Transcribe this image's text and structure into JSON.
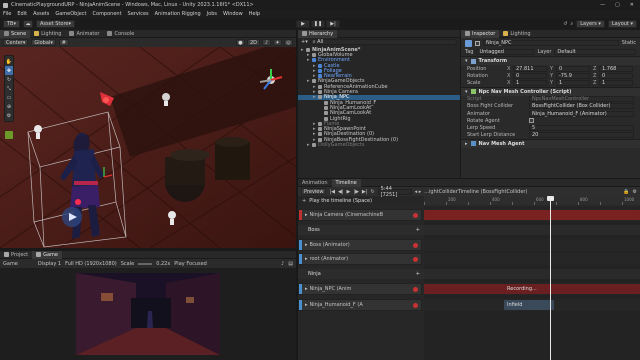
{
  "window": {
    "title": "CinematicPlaygroundURP - NinjaAnimScene - Windows, Mac, Linux - Unity 2023.1.16f1* <DX11>"
  },
  "menu": [
    "File",
    "Edit",
    "Assets",
    "GameObject",
    "Component",
    "Services",
    "Animation Rigging",
    "Jobs",
    "Window",
    "Help"
  ],
  "toolbar": {
    "account": "TB",
    "asset_store": "Asset Store",
    "layers": "Layers",
    "layout": "Layout"
  },
  "scene": {
    "tabs": [
      "Scene",
      "Lighting",
      "Animator",
      "Console"
    ],
    "pivot": "Center",
    "space": "Global",
    "view2d": "2D"
  },
  "game": {
    "tabs": [
      "Project",
      "Game"
    ],
    "mode": "Game",
    "display": "Display 1",
    "resolution": "Full HD (1920x1080)",
    "scale_label": "Scale",
    "scale_value": "0.22x",
    "play_mode": "Play Focused"
  },
  "hierarchy": {
    "tab": "Hierarchy",
    "search_prefix": "All",
    "items": [
      {
        "label": "NinjaAnimScene*",
        "depth": 0,
        "color": "#c8c8c8"
      },
      {
        "label": "GlobalVolume",
        "depth": 1,
        "color": "#c8c8c8"
      },
      {
        "label": "Environment",
        "depth": 1,
        "color": "#6fa8ff"
      },
      {
        "label": "Castle",
        "depth": 2,
        "color": "#6fa8ff"
      },
      {
        "label": "Foliage",
        "depth": 2,
        "color": "#6fa8ff"
      },
      {
        "label": "NewTerrain",
        "depth": 2,
        "color": "#6fa8ff"
      },
      {
        "label": "NinjaGameObjects",
        "depth": 1,
        "color": "#c8c8c8"
      },
      {
        "label": "ReferenceAnimationCube",
        "depth": 2,
        "color": "#c8c8c8"
      },
      {
        "label": "Ninja Camera",
        "depth": 2,
        "color": "#c8c8c8"
      },
      {
        "label": "Ninja_NPC",
        "depth": 2,
        "color": "#ffffff",
        "selected": true
      },
      {
        "label": "Ninja_Humanoid_F",
        "depth": 3,
        "color": "#c8c8c8"
      },
      {
        "label": "NinjaCamLookAt",
        "depth": 3,
        "color": "#c8c8c8"
      },
      {
        "label": "NinjaCamLookAt",
        "depth": 3,
        "color": "#c8c8c8"
      },
      {
        "label": "LightRig",
        "depth": 3,
        "color": "#c8c8c8"
      },
      {
        "label": "Flame",
        "depth": 2,
        "color": "#7a7a7a"
      },
      {
        "label": "NinjaSpawnPoint",
        "depth": 2,
        "color": "#c8c8c8"
      },
      {
        "label": "NinjaDestination (0)",
        "depth": 2,
        "color": "#c8c8c8"
      },
      {
        "label": "NinjaBossFightDestination (0)",
        "depth": 2,
        "color": "#c8c8c8"
      },
      {
        "label": "DollyGameObjects",
        "depth": 1,
        "color": "#7a7a7a"
      }
    ]
  },
  "inspector": {
    "tabs": [
      "Inspector",
      "Lighting"
    ],
    "object_name": "Ninja_NPC",
    "static_label": "Static",
    "tag_label": "Tag",
    "tag_value": "Untagged",
    "layer_label": "Layer",
    "layer_value": "Default",
    "transform": {
      "header": "Transform",
      "position": {
        "label": "Position",
        "x": "27.811",
        "y": "0",
        "z": "1.768"
      },
      "rotation": {
        "label": "Rotation",
        "x": "0",
        "y": "-75.9",
        "z": "0"
      },
      "scale": {
        "label": "Scale",
        "x": "1",
        "y": "1",
        "z": "1"
      }
    },
    "npc_script": {
      "header": "Npc Nav Mesh Controller (Script)",
      "rows": [
        {
          "label": "Script",
          "value": "NpcNavMeshController",
          "dim": true
        },
        {
          "label": "Boss Fight Collider",
          "value": "BossFightCollider (Box Collider)"
        },
        {
          "label": "Animator",
          "value": "Ninja_Humanoid_F (Animator)"
        },
        {
          "label": "Rotate Agent",
          "value": ""
        },
        {
          "label": "Lerp Speed",
          "value": "5"
        },
        {
          "label": "Start Lerp Distance",
          "value": "20"
        }
      ]
    },
    "nav_agent": {
      "header": "Nav Mesh Agent"
    }
  },
  "timeline": {
    "tabs": [
      "Animation",
      "Timeline"
    ],
    "preview": "Preview",
    "time": "5:44 [7251]",
    "asset": "...ightColliderTimeline (BossFightCollider)",
    "play_label": "Play the timeline (Space)",
    "ruler": [
      "",
      "200",
      "",
      "400",
      "",
      "600",
      "",
      "800",
      "",
      "1000"
    ],
    "groups": [
      {
        "name": "Ninja Camera (CinemachineB",
        "type": "track"
      },
      {
        "name": "Boss",
        "type": "group"
      },
      {
        "name": "Boss (Animator)",
        "type": "track"
      },
      {
        "name": "root (Animator)",
        "type": "track"
      },
      {
        "name": "Ninja",
        "type": "group"
      },
      {
        "name": "Ninja_NPC (Anim",
        "type": "track",
        "clip": "Recording..."
      },
      {
        "name": "Ninja_Humanoid_F (A",
        "type": "track",
        "clip": "Infield"
      }
    ]
  }
}
